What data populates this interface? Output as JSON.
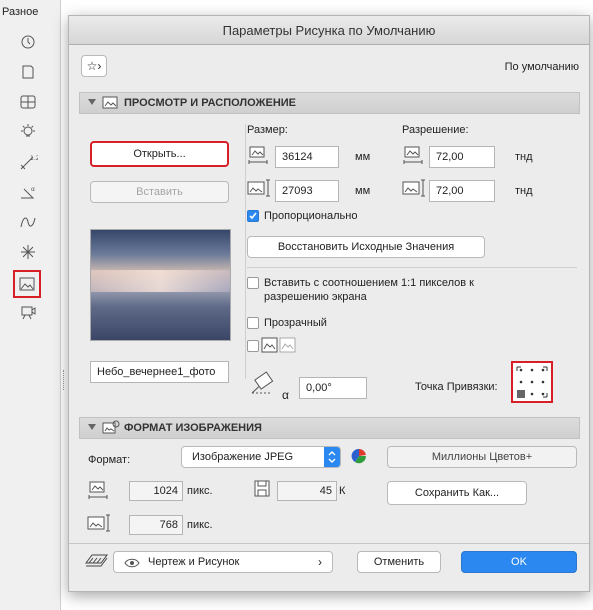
{
  "toolbox": {
    "title": "Разное"
  },
  "dialog": {
    "title": "Параметры Рисунка по Умолчанию",
    "favorites_label": "☆›",
    "default_label": "По умолчанию",
    "section1_title": "ПРОСМОТР И РАСПОЛОЖЕНИЕ",
    "open_button": "Открыть...",
    "paste_button": "Вставить",
    "size_label": "Размер:",
    "resolution_label": "Разрешение:",
    "width_value": "36124",
    "height_value": "27093",
    "size_unit": "мм",
    "res_h_value": "72,00",
    "res_v_value": "72,00",
    "res_unit": "тнд",
    "proportional_label": "Пропорционально",
    "restore_button": "Восстановить Исходные Значения",
    "insert_1to1_label": "Вставить с соотношением 1:1 пикселов к разрешению экрана",
    "transparent_label": "Прозрачный",
    "filename_value": "Небо_вечернее1_фото",
    "angle_value": "0,00°",
    "angle_symbol": "α",
    "anchor_label": "Точка Привязки:",
    "section2_title": "ФОРМАТ ИЗОБРАЖЕНИЯ",
    "format_label": "Формат:",
    "format_value": "Изображение JPEG",
    "colors_button": "Миллионы Цветов+",
    "pixels_w": "1024",
    "pixels_h": "768",
    "pixels_unit": "пикс.",
    "filesize_value": "45",
    "filesize_unit": "К",
    "save_as_button": "Сохранить Как...",
    "layer_value": "Чертеж и Рисунок",
    "cancel_button": "Отменить",
    "ok_button": "OK"
  },
  "colors": {
    "accent": "#2a88f0",
    "highlight": "#d61f26"
  }
}
